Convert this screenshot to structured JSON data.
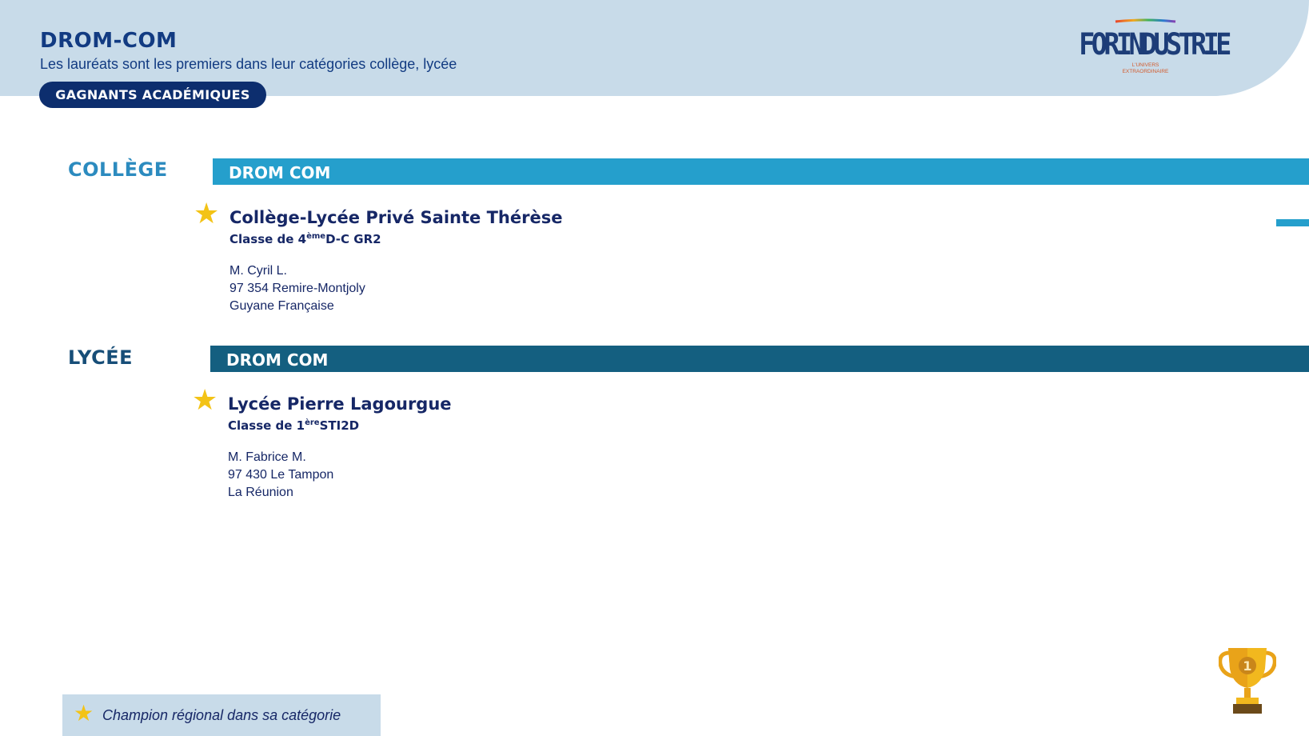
{
  "header": {
    "title": "DROM-COM",
    "subtitle": "Les lauréats sont les premiers dans leur catégories collège, lycée",
    "pill_label": "GAGNANTS ACADÉMIQUES"
  },
  "logo": {
    "wordmark": "FORINDUSTRIE",
    "tagline": "L'UNIVERS EXTRAORDINAIRE"
  },
  "sections": {
    "college": {
      "category": "COLLÈGE",
      "band": "DROM COM",
      "winner": {
        "school": "Collège-Lycée Privé Sainte Thérèse",
        "class_prefix": "Classe de 4",
        "class_sup": "ème",
        "class_suffix": "D-C GR2",
        "contact": "M. Cyril L.",
        "address": "97 354 Remire-Montjoly",
        "region": "Guyane Française"
      }
    },
    "lycee": {
      "category": "LYCÉE",
      "band": "DROM COM",
      "winner": {
        "school": "Lycée Pierre Lagourgue",
        "class_prefix": "Classe de 1",
        "class_sup": "ère",
        "class_suffix": "STI2D",
        "contact": "M. Fabrice M.",
        "address": "97 430 Le Tampon",
        "region": "La Réunion"
      }
    }
  },
  "legend": {
    "text": "Champion régional dans sa catégorie"
  },
  "icons": {
    "star": "star-icon",
    "trophy": "trophy-icon",
    "trophy_rank": "1"
  },
  "colors": {
    "header_bg": "#c8dbe9",
    "navy": "#0d2e6e",
    "college_blue": "#259fcc",
    "lycee_blue": "#145f80",
    "star_gold": "#f3c316"
  }
}
